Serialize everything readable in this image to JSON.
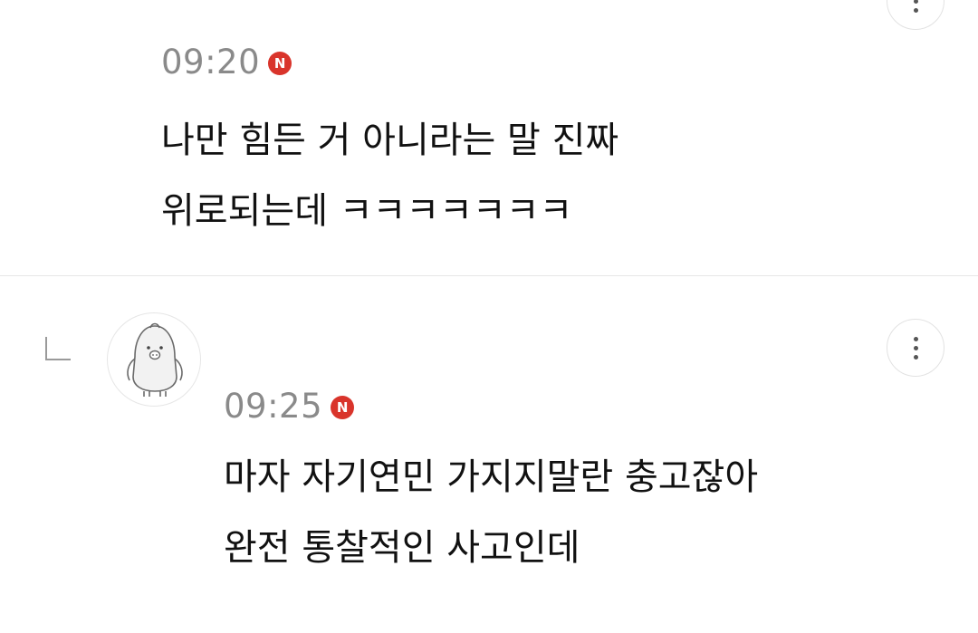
{
  "comments": [
    {
      "time": "09:20",
      "badge": "N",
      "lines": [
        "나만 힘든 거 아니라는 말 진짜",
        "위로되는데 ㅋㅋㅋㅋㅋㅋㅋ"
      ],
      "is_reply": false
    },
    {
      "time": "09:25",
      "badge": "N",
      "lines": [
        "마자 자기연민 가지지말란 충고잖아",
        "완전 통찰적인 사고인데"
      ],
      "is_reply": true
    }
  ],
  "icons": {
    "more": "more-vertical-icon",
    "new_badge": "new-badge-icon",
    "reply": "reply-arrow-icon",
    "avatar": "penguin-avatar"
  },
  "colors": {
    "badge": "#d9342b",
    "time": "#8a8a8a",
    "text": "#111111",
    "divider": "#e6e6e6"
  }
}
